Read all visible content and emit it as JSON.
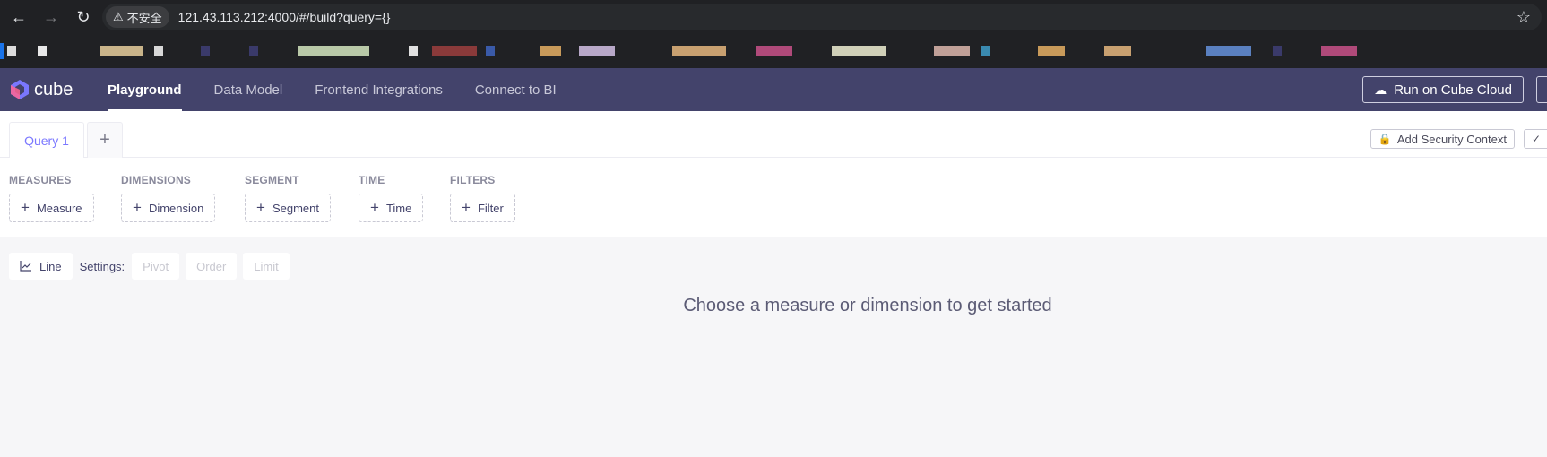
{
  "browser": {
    "security_label": "不安全",
    "url": "121.43.113.212:4000/#/build?query={}"
  },
  "app": {
    "logo_text": "cube",
    "nav": [
      {
        "label": "Playground"
      },
      {
        "label": "Data Model"
      },
      {
        "label": "Frontend Integrations"
      },
      {
        "label": "Connect to BI"
      }
    ],
    "run_cloud_label": "Run on Cube Cloud"
  },
  "query_tabs": {
    "active_label": "Query 1",
    "add_label": "+",
    "security_context_label": "Add Security Context"
  },
  "members": {
    "measures": {
      "label": "MEASURES",
      "button": "Measure"
    },
    "dimensions": {
      "label": "DIMENSIONS",
      "button": "Dimension"
    },
    "segment": {
      "label": "SEGMENT",
      "button": "Segment"
    },
    "time": {
      "label": "TIME",
      "button": "Time"
    },
    "filters": {
      "label": "FILTERS",
      "button": "Filter"
    }
  },
  "toolbar": {
    "chart_type": "Line",
    "settings_label": "Settings:",
    "pivot": "Pivot",
    "order": "Order",
    "limit": "Limit"
  },
  "empty_message": "Choose a measure or dimension to get started",
  "colors": {
    "header_bg": "#43436b",
    "accent": "#7a77ff",
    "page_bg": "#f6f6f8"
  }
}
